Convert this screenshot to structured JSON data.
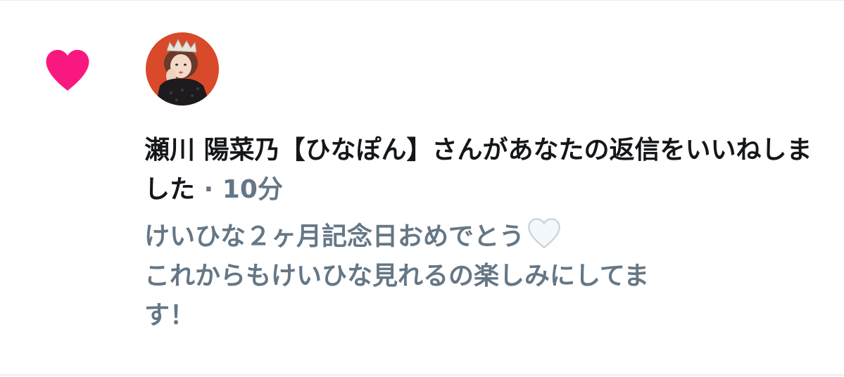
{
  "notification": {
    "user_name": "瀬川 陽菜乃【ひなぽん】",
    "action_text": "さんがあなたの返信をいいねしました",
    "separator": " · ",
    "time": "10分",
    "tweet_line1": "けいひな２ヶ月記念日おめでとう",
    "tweet_line2": "これからもけいひな見れるの楽しみにしてま",
    "tweet_line3": "す！"
  },
  "icons": {
    "like": "heart-icon",
    "emoji": "white-heart-emoji"
  },
  "colors": {
    "like_pink": "#f91880",
    "primary_text": "#14171a",
    "secondary_text": "#657786",
    "divider": "#e6ecf0",
    "avatar_background": "#d94a2a"
  }
}
